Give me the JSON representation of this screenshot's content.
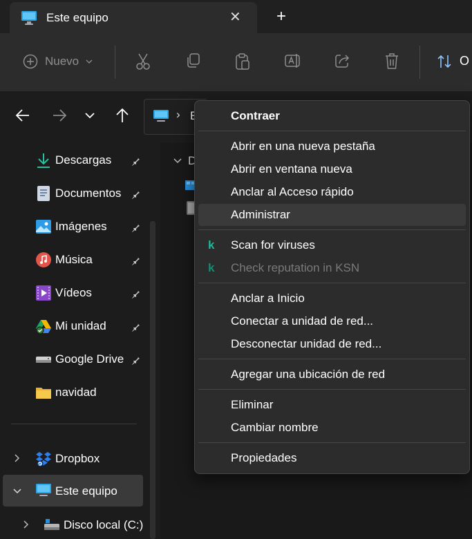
{
  "window": {
    "tab_title": "Este equipo",
    "new_tab_symbol": "+",
    "close_symbol": "✕"
  },
  "toolbar": {
    "new_label": "Nuevo",
    "sort_label": "O",
    "icons": [
      "cut-icon",
      "copy-icon",
      "paste-icon",
      "rename-icon",
      "share-icon",
      "delete-icon",
      "sort-icon"
    ]
  },
  "address": {
    "visible_fragment": "E",
    "separator": "›"
  },
  "content": {
    "group_letter": "D"
  },
  "sidebar": {
    "quick_access": [
      {
        "label": "Descargas",
        "icon": "download-icon",
        "pinned": true
      },
      {
        "label": "Documentos",
        "icon": "documents-icon",
        "pinned": true
      },
      {
        "label": "Imágenes",
        "icon": "images-icon",
        "pinned": true
      },
      {
        "label": "Música",
        "icon": "music-icon",
        "pinned": true
      },
      {
        "label": "Vídeos",
        "icon": "videos-icon",
        "pinned": true
      },
      {
        "label": "Mi unidad",
        "icon": "google-drive-icon",
        "pinned": true
      },
      {
        "label": "Google Drive",
        "icon": "drive-icon",
        "pinned": true
      },
      {
        "label": "navidad",
        "icon": "folder-icon",
        "pinned": false
      }
    ],
    "tree": [
      {
        "label": "Dropbox",
        "icon": "dropbox-icon",
        "expanded": false
      },
      {
        "label": "Este equipo",
        "icon": "computer-icon",
        "expanded": true,
        "selected": true
      },
      {
        "label": "Disco local (C:)",
        "icon": "disk-icon",
        "expanded": false
      }
    ]
  },
  "context_menu": {
    "items": [
      {
        "label": "Contraer",
        "bold": true
      },
      {
        "label": "Abrir en una nueva pestaña"
      },
      {
        "label": "Abrir en ventana nueva"
      },
      {
        "label": "Anclar al Acceso rápido"
      },
      {
        "label": "Administrar",
        "hovered": true
      },
      {
        "label": "Scan for viruses",
        "icon": "k"
      },
      {
        "label": "Check reputation in KSN",
        "icon": "k",
        "disabled": true
      },
      {
        "label": "Anclar a Inicio"
      },
      {
        "label": "Conectar a unidad de red..."
      },
      {
        "label": "Desconectar unidad de red..."
      },
      {
        "label": "Agregar una ubicación de red"
      },
      {
        "label": "Eliminar"
      },
      {
        "label": "Cambiar nombre"
      },
      {
        "label": "Propiedades"
      }
    ]
  },
  "colors": {
    "accent_teal": "#1fb89a",
    "background": "#191919",
    "menu_bg": "#2c2c2c"
  }
}
